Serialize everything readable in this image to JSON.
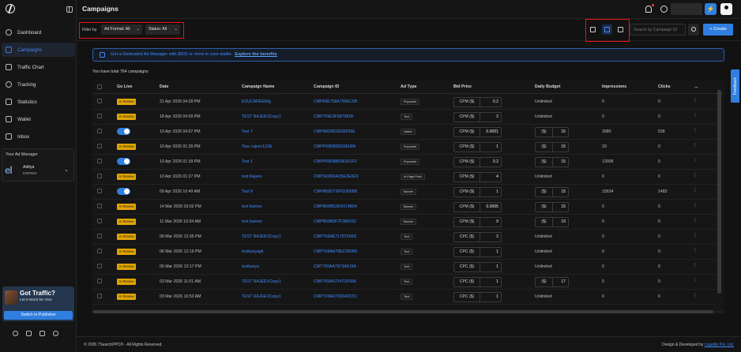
{
  "sidebar": {
    "items": [
      {
        "label": "Dashboard",
        "icon": "home-icon"
      },
      {
        "label": "Campaigns",
        "icon": "megaphone-icon",
        "active": true
      },
      {
        "label": "Traffic Chart",
        "icon": "chart-icon"
      },
      {
        "label": "Tracking",
        "icon": "tracking-icon"
      },
      {
        "label": "Statistics",
        "icon": "statistics-icon"
      },
      {
        "label": "Wallet",
        "icon": "wallet-icon"
      },
      {
        "label": "Inbox",
        "icon": "inbox-icon"
      }
    ],
    "ad_manager": {
      "title": "Your Ad Manager",
      "name": "Aditya",
      "id": "EMP804",
      "logo_text": "el"
    },
    "promo": {
      "title": "Got Traffic?",
      "subtitle": "Let It Work for You!",
      "button": "Switch to Publisher"
    }
  },
  "header": {
    "title": "Campaigns"
  },
  "filters": {
    "label": "Filter by",
    "ad_format": "Ad Format: All",
    "status": "Status: All"
  },
  "search": {
    "placeholder": "Search by Campaign ID"
  },
  "create_label": "+ Create",
  "banner": {
    "text": "Get a Dedicated Ad Manager with $500 or more in your wallet.",
    "link": "Explore the benefits"
  },
  "total_text": "You have total 764 campaigns",
  "table": {
    "headers": [
      "Date",
      "Go Live",
      "Date",
      "Campaign Name",
      "Campaign ID",
      "Ad Type",
      "Bid Price",
      "Daily Budget",
      "Impressions",
      "Clicks",
      "..."
    ],
    "rows": [
      {
        "status": "In Review",
        "date": "21 Apr 2026 04:28 PM",
        "name": "EDUCAREEEfg",
        "id": "CMP69E758A790EC5B",
        "adtype": "Popunder",
        "bid_type": "CPM ($)",
        "bid": "0.2",
        "budget_type": "",
        "budget": "Unlimited",
        "impressions": "0",
        "clicks": "0"
      },
      {
        "status": "In Review",
        "date": "18 Apr 2026 04:09 PM",
        "name": "TEST RAJEEVCopy1",
        "id": "CMP769E3F5879B0F",
        "adtype": "Text",
        "bid_type": "CPM ($)",
        "bid": "3",
        "budget_type": "",
        "budget": "Unlimited",
        "impressions": "0",
        "clicks": "0"
      },
      {
        "status": "live",
        "date": "10 Apr 2026 04:07 PM",
        "name": "Test 7",
        "id": "CMPN6D8D2E89036E",
        "adtype": "Native",
        "bid_type": "CPM ($)",
        "bid": "0.0001",
        "budget_type": "($)",
        "budget": "15",
        "impressions": "3980",
        "clicks": "538"
      },
      {
        "status": "In Review",
        "date": "10 Apr 2026 01:39 PM",
        "name": "Tesc rajeev123&",
        "id": "CMPP69D8D5D6E08A",
        "adtype": "Popunder",
        "bid_type": "CPM ($)",
        "bid": "1",
        "budget_type": "($)",
        "budget": "15",
        "impressions": "20",
        "clicks": "0"
      },
      {
        "status": "live",
        "date": "10 Apr 2026 01:39 PM",
        "name": "Test 1",
        "id": "CMPP69D8B03E501F2",
        "adtype": "Popunder",
        "bid_type": "CPM ($)",
        "bid": "0.2",
        "budget_type": "($)",
        "budget": "15",
        "impressions": "13008",
        "clicks": "0"
      },
      {
        "status": "In Review",
        "date": "10 Apr 2026 01:27 PM",
        "name": "test Rajeev",
        "id": "CMPS69D6AD5E3E0E9",
        "adtype": "In-Page Push",
        "bid_type": "CPM ($)",
        "bid": "4",
        "budget_type": "",
        "budget": "Unlimited",
        "impressions": "0",
        "clicks": "0"
      },
      {
        "status": "live",
        "date": "09 Apr 2026 10:49 AM",
        "name": "Test 8",
        "id": "CMPB69D736FD3068B",
        "adtype": "Banner",
        "bid_type": "CPM ($)",
        "bid": "1",
        "budget_type": "($)",
        "budget": "15",
        "impressions": "15634",
        "clicks": "1483"
      },
      {
        "status": "In Review",
        "date": "14 Mar 2026 03:02 PM",
        "name": "test banner",
        "id": "CMPB69B5281FC4B04",
        "adtype": "Banner",
        "bid_type": "CPM ($)",
        "bid": "0.0005",
        "budget_type": "($)",
        "budget": "15",
        "impressions": "0",
        "clicks": "0"
      },
      {
        "status": "In Review",
        "date": "11 Mar 2026 10:34 AM",
        "name": "test banner",
        "id": "CMPB69B0F7F386162",
        "adtype": "Banner",
        "bid_type": "CPM ($)",
        "bid": "9",
        "budget_type": "($)",
        "budget": "19",
        "impressions": "0",
        "clicks": "0"
      },
      {
        "status": "In Review",
        "date": "09 Mar 2026 12:36 PM",
        "name": "TEST RAJEEVCopy1",
        "id": "CMPT69AE71787696D",
        "adtype": "Text",
        "bid_type": "CPC ($)",
        "bid": "3",
        "budget_type": "",
        "budget": "Unlimited",
        "impressions": "0",
        "clicks": "0"
      },
      {
        "status": "In Review",
        "date": "06 Mar 2026 12:19 PM",
        "name": "testkavyagil",
        "id": "CMPT69AA78EC982B0",
        "adtype": "Text",
        "bid_type": "CPC ($)",
        "bid": "1",
        "budget_type": "",
        "budget": "Unlimited",
        "impressions": "0",
        "clicks": "0"
      },
      {
        "status": "In Review",
        "date": "06 Mar 2026 12:17 PM",
        "name": "testkavya",
        "id": "CMT769AA7873A616A",
        "adtype": "Text",
        "bid_type": "CPC ($)",
        "bid": "1",
        "budget_type": "",
        "budget": "Unlimited",
        "impressions": "0",
        "clicks": "0"
      },
      {
        "status": "In Review",
        "date": "03 Mar 2026 11:01 AM",
        "name": "TEST RAJEEVCopy1",
        "id": "CMP769A67247DF568",
        "adtype": "Text",
        "bid_type": "CPC ($)",
        "bid": "1",
        "budget_type": "($)",
        "budget": "17",
        "impressions": "0",
        "clicks": "0"
      },
      {
        "status": "In Review",
        "date": "03 Mar 2026 10:53 AM",
        "name": "TEST RAJEEVCopy1",
        "id": "CMPT69A6703DA3C51",
        "adtype": "Text",
        "bid_type": "CPC ($)",
        "bid": "1",
        "budget_type": "",
        "budget": "Unlimited",
        "impressions": "0",
        "clicks": "0"
      }
    ]
  },
  "feedback_label": "Feedback",
  "footer": {
    "left": "© 2026 7SearchPPC® - All Rights Reserved.",
    "right_prefix": "Design & Developed by ",
    "right_link": "Logelite Pvt. Ltd."
  },
  "colors": {
    "accent": "#2f7fe0",
    "link": "#3d8bff",
    "review": "#e0a400",
    "highlight_border": "#ee1111"
  }
}
